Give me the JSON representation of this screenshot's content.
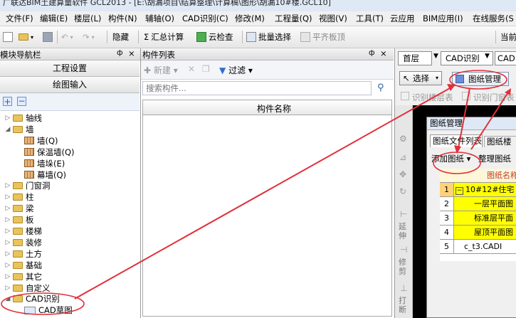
{
  "window": {
    "title": "广联达BIM土建算量软件 GCL2013 - [E:\\胡漏项目\\结算整理\\计算稿\\图形\\胡漏10#楼.GCL10]"
  },
  "menu": [
    "文件(F)",
    "编辑(E)",
    "楼层(L)",
    "构件(N)",
    "辅轴(O)",
    "CAD识别(C)",
    "修改(M)",
    "工程量(Q)",
    "视图(V)",
    "工具(T)",
    "云应用",
    "BIM应用(I)",
    "在线服务(S"
  ],
  "toolbar": {
    "hide": "隐藏",
    "calc": "汇总计算",
    "cloud_check": "云检查",
    "batch_select": "批量选择",
    "flat_slab": "平齐板顶",
    "current": "当前"
  },
  "nav": {
    "title": "模块导航栏",
    "pin_glyphs": [
      "ф",
      "×"
    ],
    "engineering_settings": "工程设置",
    "drawing_input": "绘图输入",
    "tree": [
      {
        "label": "轴线",
        "level": 0,
        "state": "collapsed",
        "type": "folder"
      },
      {
        "label": "墙",
        "level": 0,
        "state": "expanded",
        "type": "folder"
      },
      {
        "label": "墙(Q)",
        "level": 1,
        "type": "wall"
      },
      {
        "label": "保温墙(Q)",
        "level": 1,
        "type": "wall"
      },
      {
        "label": "墙垛(E)",
        "level": 1,
        "type": "wall"
      },
      {
        "label": "幕墙(Q)",
        "level": 1,
        "type": "wall"
      },
      {
        "label": "门窗洞",
        "level": 0,
        "state": "collapsed",
        "type": "folder"
      },
      {
        "label": "柱",
        "level": 0,
        "state": "collapsed",
        "type": "folder"
      },
      {
        "label": "梁",
        "level": 0,
        "state": "collapsed",
        "type": "folder"
      },
      {
        "label": "板",
        "level": 0,
        "state": "collapsed",
        "type": "folder"
      },
      {
        "label": "楼梯",
        "level": 0,
        "state": "collapsed",
        "type": "folder"
      },
      {
        "label": "装修",
        "level": 0,
        "state": "collapsed",
        "type": "folder"
      },
      {
        "label": "土方",
        "level": 0,
        "state": "collapsed",
        "type": "folder"
      },
      {
        "label": "基础",
        "level": 0,
        "state": "collapsed",
        "type": "folder"
      },
      {
        "label": "其它",
        "level": 0,
        "state": "collapsed",
        "type": "folder"
      },
      {
        "label": "自定义",
        "level": 0,
        "state": "collapsed",
        "type": "folder"
      },
      {
        "label": "CAD识别",
        "level": 0,
        "state": "expanded",
        "type": "folder"
      },
      {
        "label": "CAD草图",
        "level": 1,
        "type": "cad"
      }
    ]
  },
  "component_list": {
    "title": "构件列表",
    "pin_glyphs": [
      "ф",
      "×"
    ],
    "new_label": "新建",
    "filter_label": "过滤",
    "search_placeholder": "搜索构件...",
    "column_header": "构件名称"
  },
  "cad": {
    "floor": "首层",
    "cad_recognize": "CAD识别",
    "cad_short": "CAD",
    "select_label": "选择",
    "drawing_mgmt": "图纸管理",
    "recognize_floor_table": "识别楼层表",
    "recognize_door": "识别门窗表"
  },
  "side_tools": [
    "延伸",
    "修剪",
    "打断"
  ],
  "drawing_dialog": {
    "title": "图纸管理",
    "tab_files": "图纸文件列表",
    "tab_floor": "图纸楼",
    "add_drawing": "添加图纸",
    "organize": "整理图纸",
    "header": "图纸名称",
    "rows": [
      {
        "num": "1",
        "name": "10#12#住宅（",
        "highlight": true,
        "toggle": "−"
      },
      {
        "num": "2",
        "name": "一层平面图",
        "highlight": true
      },
      {
        "num": "3",
        "name": "标准层平面",
        "highlight": true
      },
      {
        "num": "4",
        "name": "屋顶平面图",
        "highlight": true
      },
      {
        "num": "5",
        "name": "c_t3.CADI",
        "highlight": false
      }
    ]
  },
  "colors": {
    "annotation": "#e0303a",
    "highlight": "#ffff00",
    "cad_bg": "#000000"
  }
}
